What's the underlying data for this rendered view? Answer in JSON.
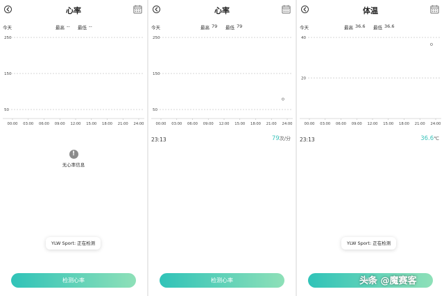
{
  "watermark": "头条 @魔赛客",
  "panels": [
    {
      "title": "心率",
      "today_label": "今天",
      "max_label": "最高",
      "max_value": "--",
      "min_label": "最低",
      "min_value": "--",
      "no_data_text": "无心率信息",
      "toast": "YLW Sport: 正在检测",
      "button_label": "检测心率"
    },
    {
      "title": "心率",
      "today_label": "今天",
      "max_label": "最高",
      "max_value": "79",
      "min_label": "最低",
      "min_value": "79",
      "reading_time": "23:13",
      "reading_value": "79",
      "reading_unit": "次/分",
      "button_label": "检测心率"
    },
    {
      "title": "体温",
      "today_label": "今天",
      "max_label": "最高",
      "max_value": "36.6",
      "min_label": "最低",
      "min_value": "36.6",
      "reading_time": "23:13",
      "reading_value": "36.6",
      "reading_unit": "℃",
      "toast": "YLW Sport: 正在检测",
      "button_label": "检测"
    }
  ],
  "chart_data": [
    {
      "type": "scatter",
      "title": "",
      "x_ticks": [
        "00:00",
        "03:00",
        "06:00",
        "09:00",
        "12:00",
        "15:00",
        "18:00",
        "21:00",
        "24:00"
      ],
      "x_range": [
        0,
        24
      ],
      "y_ticks": [
        250,
        150,
        50
      ],
      "ylim": [
        25,
        250
      ],
      "grid": true,
      "points": []
    },
    {
      "type": "scatter",
      "title": "",
      "x_ticks": [
        "00:00",
        "03:00",
        "06:00",
        "09:00",
        "12:00",
        "15:00",
        "18:00",
        "21:00",
        "24:00"
      ],
      "x_range": [
        0,
        24
      ],
      "y_ticks": [
        250,
        150,
        50
      ],
      "ylim": [
        25,
        250
      ],
      "grid": true,
      "points": [
        {
          "x": 23.2,
          "y": 79
        }
      ]
    },
    {
      "type": "scatter",
      "title": "",
      "x_ticks": [
        "00:00",
        "03:00",
        "06:00",
        "09:00",
        "12:00",
        "15:00",
        "18:00",
        "21:00",
        "24:00"
      ],
      "x_range": [
        0,
        24
      ],
      "y_ticks": [
        40,
        20
      ],
      "ylim": [
        0,
        40
      ],
      "grid": true,
      "points": [
        {
          "x": 23.2,
          "y": 36.6
        }
      ]
    }
  ]
}
